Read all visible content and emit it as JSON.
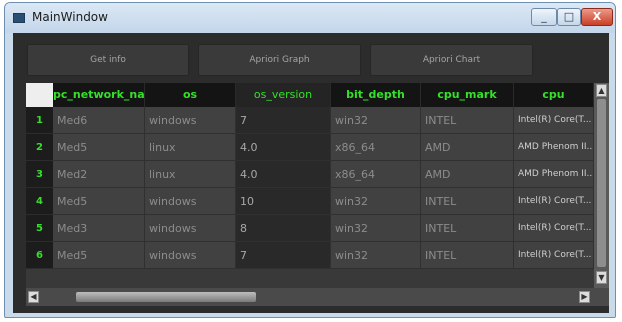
{
  "window": {
    "title": "MainWindow",
    "minimize": "_",
    "maximize": "□",
    "close": "X"
  },
  "buttons": {
    "get_info": "Get info",
    "apriori_graph": "Apriori Graph",
    "apriori_chart": "Apriori Chart"
  },
  "table": {
    "columns": [
      "pc_network_name",
      "os",
      "os_version",
      "bit_depth",
      "cpu_mark",
      "cpu"
    ],
    "rows": [
      {
        "num": "1",
        "cells": [
          "Med6",
          "windows",
          "7",
          "win32",
          "INTEL",
          "Intel(R) Core(T..."
        ]
      },
      {
        "num": "2",
        "cells": [
          "Med5",
          "linux",
          "4.0",
          "x86_64",
          "AMD",
          "AMD Phenom II..."
        ]
      },
      {
        "num": "3",
        "cells": [
          "Med2",
          "linux",
          "4.0",
          "x86_64",
          "AMD",
          "AMD Phenom II..."
        ]
      },
      {
        "num": "4",
        "cells": [
          "Med5",
          "windows",
          "10",
          "win32",
          "INTEL",
          "Intel(R) Core(T..."
        ]
      },
      {
        "num": "5",
        "cells": [
          "Med3",
          "windows",
          "8",
          "win32",
          "INTEL",
          "Intel(R) Core(T..."
        ]
      },
      {
        "num": "6",
        "cells": [
          "Med5",
          "windows",
          "7",
          "win32",
          "INTEL",
          "Intel(R) Core(T..."
        ]
      }
    ]
  },
  "colors": {
    "header_text": "#35e02a",
    "client_bg": "#2c2c2c"
  }
}
